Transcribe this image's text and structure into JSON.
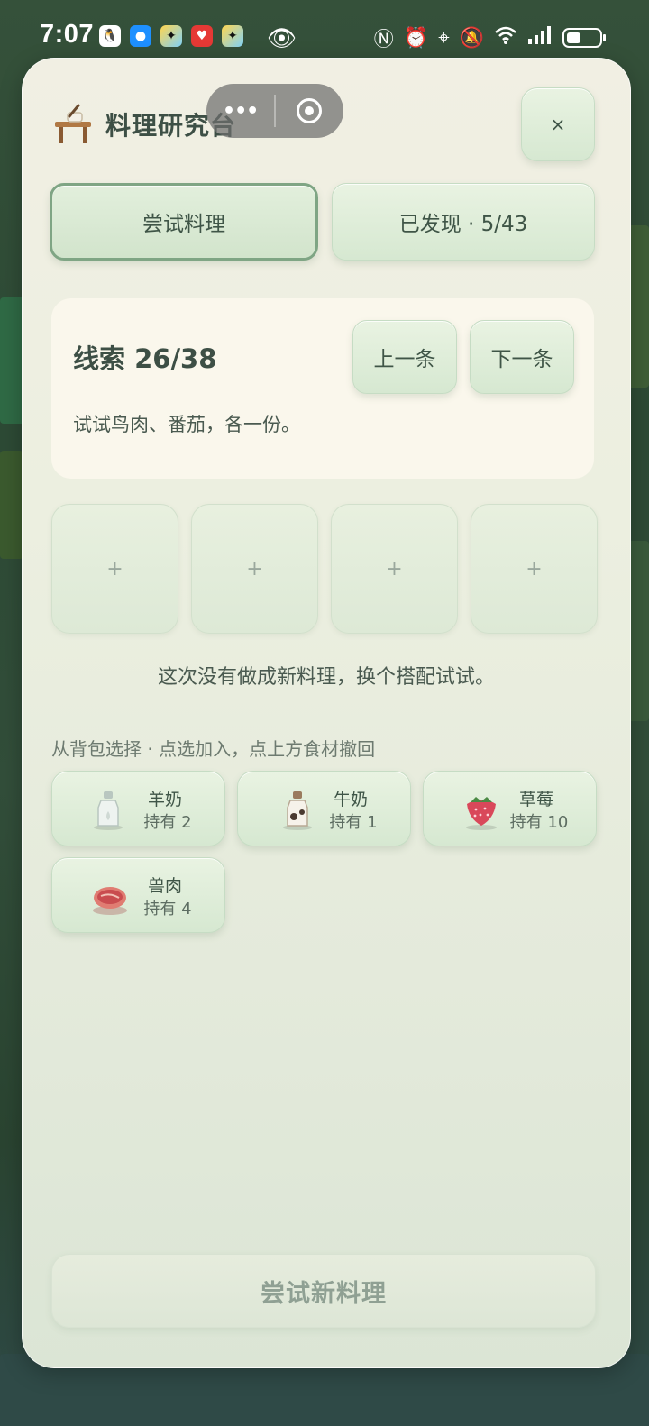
{
  "status_bar": {
    "time": "7:07",
    "app_icons": [
      "qq-icon",
      "message-icon",
      "app-icon",
      "heart-app-icon",
      "app-icon"
    ],
    "right_icons": [
      "nfc-icon",
      "alarm-icon",
      "location-icon",
      "mute-icon",
      "wifi-icon",
      "signal-icon",
      "battery-icon"
    ],
    "battery_level": 0.45
  },
  "panel": {
    "title": "料理研究台",
    "close_label": "×"
  },
  "tabs": {
    "try": "尝试料理",
    "found": "已发现 · 5/43"
  },
  "clue": {
    "title": "线索 26/38",
    "prev_label": "上一条",
    "next_label": "下一条",
    "text": "试试鸟肉、番茄，各一份。"
  },
  "slots": [
    "+",
    "+",
    "+",
    "+"
  ],
  "result_message": "这次没有做成新料理，换个搭配试试。",
  "bag_hint": "从背包选择 · 点选加入，点上方食材撤回",
  "items": [
    {
      "name": "羊奶",
      "count": "持有 2",
      "icon": "goat-milk-bottle-icon"
    },
    {
      "name": "牛奶",
      "count": "持有 1",
      "icon": "milk-bottle-icon"
    },
    {
      "name": "草莓",
      "count": "持有 10",
      "icon": "strawberry-icon"
    },
    {
      "name": "兽肉",
      "count": "持有 4",
      "icon": "meat-icon"
    }
  ],
  "cook_button": "尝试新料理",
  "colors": {
    "accent_border": "#7fa584",
    "panel_bg": "#f1efe3",
    "button_bg": "#d6e8d1",
    "text_main": "#3d4f45"
  }
}
